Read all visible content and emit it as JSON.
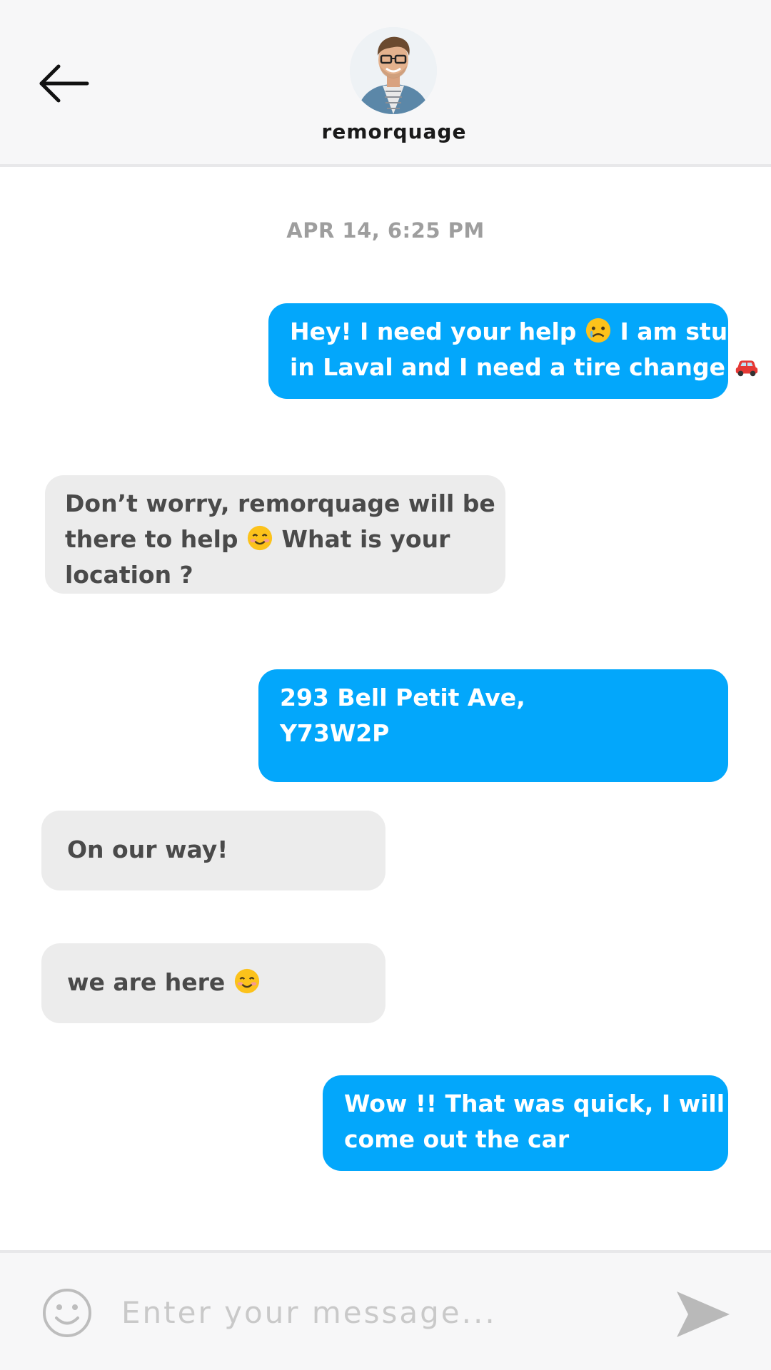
{
  "header": {
    "contact_name": "remorquage"
  },
  "conversation": {
    "timestamp": "APR 14, 6:25 PM",
    "messages": [
      {
        "from": "me",
        "lines": [
          "Hey! I need your help",
          "I am stuck",
          "in Laval and I need a tire change"
        ],
        "emojis": [
          "sad-face-emoji",
          "red-car-emoji"
        ]
      },
      {
        "from": "them",
        "lines": [
          "Don’t worry, remorquage will be",
          "there to help",
          "What is your",
          "location ?"
        ],
        "emojis": [
          "smiling-face-emoji"
        ]
      },
      {
        "from": "me",
        "lines": [
          "293 Bell Petit Ave,",
          "Y73W2P"
        ]
      },
      {
        "from": "them",
        "lines": [
          "On our way!"
        ]
      },
      {
        "from": "them",
        "lines": [
          "we are here"
        ],
        "emojis": [
          "smiling-face-emoji"
        ]
      },
      {
        "from": "me",
        "lines": [
          "Wow !! That was quick, I will",
          "come out the car"
        ]
      }
    ]
  },
  "composer": {
    "placeholder": "Enter your message..."
  },
  "colors": {
    "sent_bubble": "#03a7fb",
    "received_bubble": "#ececec",
    "header_bg": "#f7f7f8"
  },
  "icons": {
    "back": "back-arrow-icon",
    "emoji": "smiley-icon",
    "send": "send-icon"
  }
}
